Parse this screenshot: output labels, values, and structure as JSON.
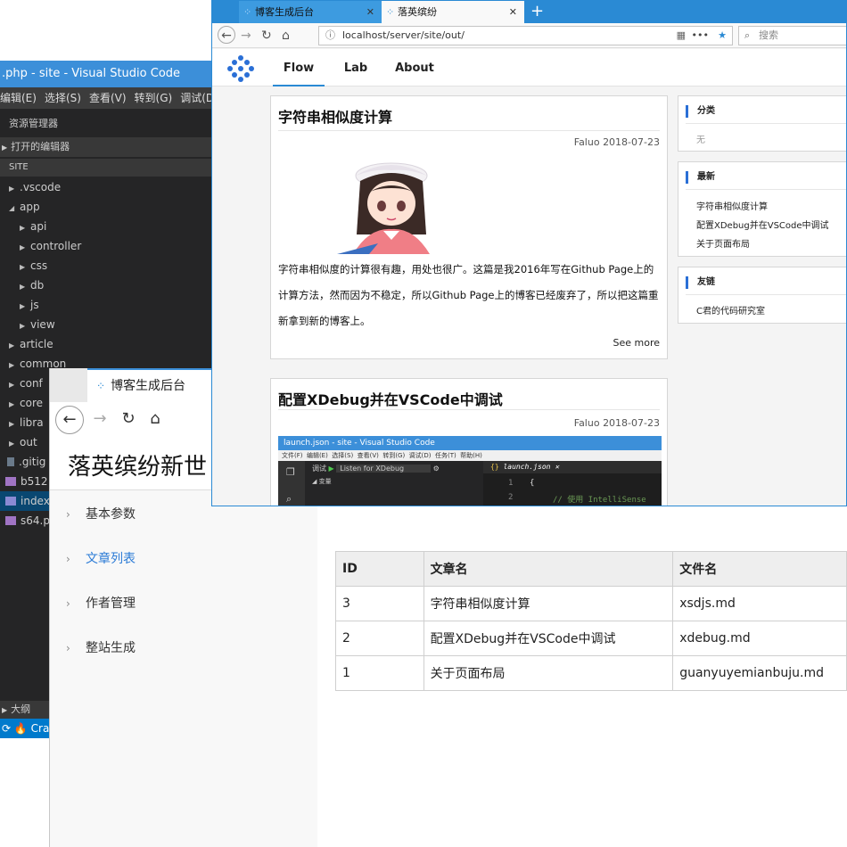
{
  "vscode": {
    "title": ".php - site - Visual Studio Code",
    "menu": [
      "编辑(E)",
      "选择(S)",
      "查看(V)",
      "转到(G)",
      "调试(D"
    ],
    "explorer_title": "资源管理器",
    "open_editors": "打开的编辑器",
    "root_folder": "SITE",
    "tree": [
      ".vscode",
      "app",
      "api",
      "controller",
      "css",
      "db",
      "js",
      "view",
      "article",
      "common",
      "conf",
      "core",
      "libra",
      "out",
      ".gitig",
      "b512",
      "index",
      "s64.p"
    ],
    "outline": "大纲",
    "status": "Cran"
  },
  "admin": {
    "tab_title": "博客生成后台",
    "heading": "落英缤纷新世",
    "sidebar": [
      "基本参数",
      "文章列表",
      "作者管理",
      "整站生成"
    ],
    "table": {
      "headers": [
        "ID",
        "文章名",
        "文件名"
      ],
      "rows": [
        [
          "3",
          "字符串相似度计算",
          "xsdjs.md"
        ],
        [
          "2",
          "配置XDebug并在VSCode中调试",
          "xdebug.md"
        ],
        [
          "1",
          "关于页面布局",
          "guanyuyemianbuju.md"
        ]
      ]
    }
  },
  "firefox": {
    "tabs": [
      "博客生成后台",
      "落英缤纷"
    ],
    "url": "localhost/server/site/out/",
    "search_placeholder": "搜索",
    "site_nav": [
      "Flow",
      "Lab",
      "About"
    ],
    "posts": [
      {
        "title": "字符串相似度计算",
        "meta": "Faluo 2018-07-23",
        "excerpt": "字符串相似度的计算很有趣，用处也很广。这篇是我2016年写在Github Page上的计算方法，然而因为不稳定，所以Github Page上的博客已经废弃了，所以把这篇重新拿到新的博客上。",
        "more": "See more"
      },
      {
        "title": "配置XDebug并在VSCode中调试",
        "meta": "Faluo 2018-07-23"
      }
    ],
    "embedded_screenshot": {
      "title": "launch.json - site - Visual Studio Code",
      "menu": "文件(F)  编辑(E)  选择(S)  查看(V)  转到(G)  调试(D)  任务(T)  帮助(H)",
      "debug_label": "调试",
      "config": "Listen for XDebug",
      "file_tab": "launch.json",
      "var_label": "变量",
      "line1": "1",
      "line2": "2",
      "code1": "{",
      "code2": "// 使用 IntelliSense"
    },
    "widgets": {
      "category": {
        "title": "分类",
        "empty": "无"
      },
      "latest": {
        "title": "最新",
        "items": [
          "字符串相似度计算",
          "配置XDebug并在VSCode中调试",
          "关于页面布局"
        ]
      },
      "friends": {
        "title": "友链",
        "items": [
          "C君的代码研究室"
        ]
      }
    }
  },
  "colors": {
    "accent": "#2a8ad4",
    "vscode_blue": "#007acc",
    "link_active": "#2b7bd6"
  }
}
